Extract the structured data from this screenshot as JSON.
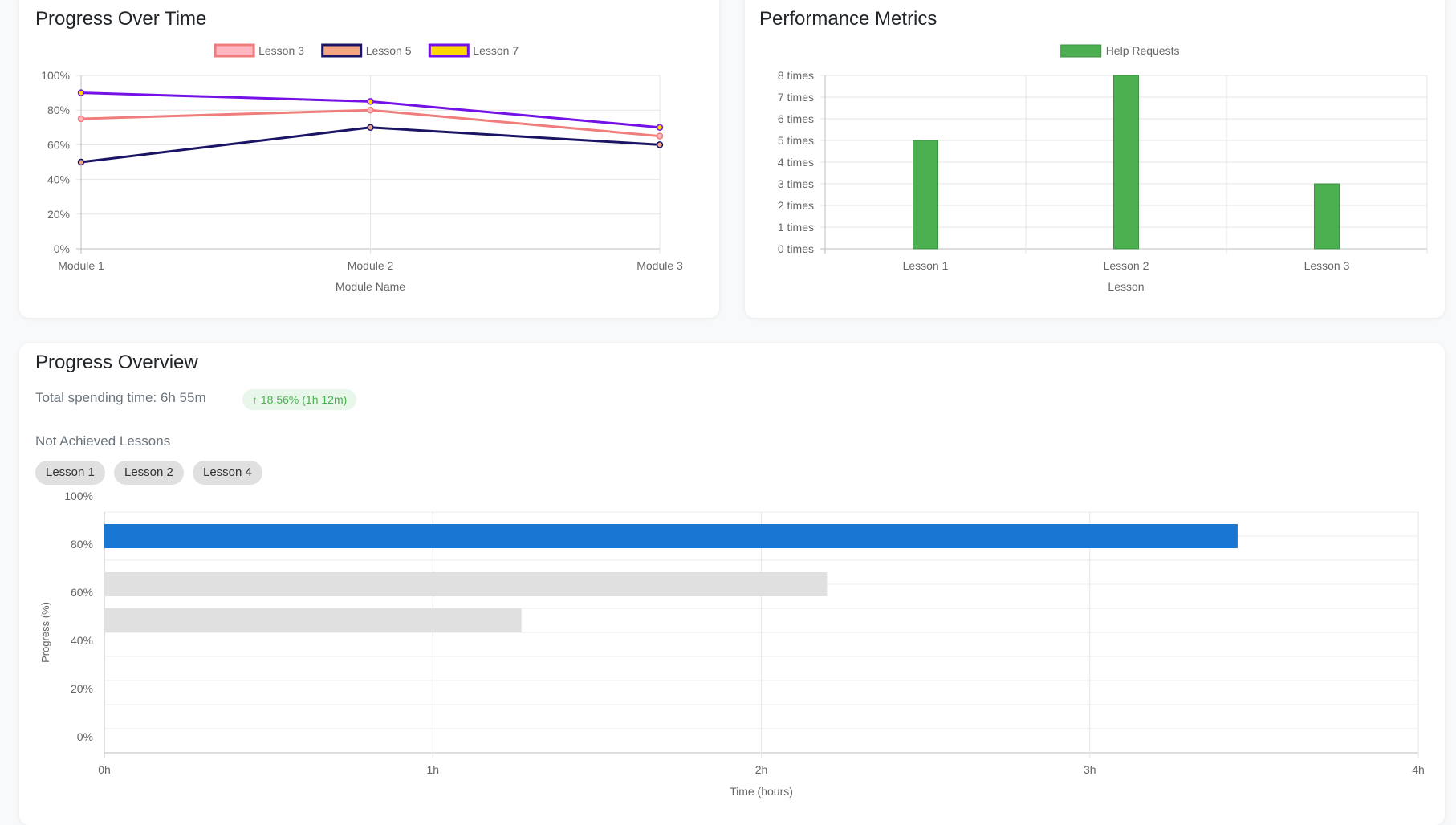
{
  "progress_card": {
    "title": "Progress Over Time",
    "chart_data": {
      "type": "line",
      "categories": [
        "Module 1",
        "Module 2",
        "Module 3"
      ],
      "xlabel": "Module Name",
      "ylabel": "",
      "ylim": [
        0,
        100
      ],
      "y_ticks": [
        "0%",
        "20%",
        "40%",
        "60%",
        "80%",
        "100%"
      ],
      "grid": true,
      "legend": "top",
      "series": [
        {
          "name": "Lesson 3",
          "values": [
            75,
            80,
            65
          ],
          "line_color": "#f07c7c",
          "fill_color": "#ffb6c1"
        },
        {
          "name": "Lesson 5",
          "values": [
            50,
            70,
            60
          ],
          "line_color": "#1b1464",
          "fill_color": "#f4a582"
        },
        {
          "name": "Lesson 7",
          "values": [
            90,
            85,
            70
          ],
          "line_color": "#7311e6",
          "fill_color": "#ffd700"
        }
      ]
    }
  },
  "metrics_card": {
    "title": "Performance Metrics",
    "chart_data": {
      "type": "bar",
      "categories": [
        "Lesson 1",
        "Lesson 2",
        "Lesson 3"
      ],
      "xlabel": "Lesson",
      "ylabel": "",
      "ylim": [
        0,
        8
      ],
      "y_ticks": [
        "0 times",
        "1 times",
        "2 times",
        "3 times",
        "4 times",
        "5 times",
        "6 times",
        "7 times",
        "8 times"
      ],
      "grid": true,
      "legend": "top",
      "series": [
        {
          "name": "Help Requests",
          "values": [
            5,
            8,
            3
          ],
          "color": "#4caf50"
        }
      ]
    }
  },
  "overview_card": {
    "title": "Progress Overview",
    "total_time": "Total spending time: 6h 55m",
    "change_badge": "↑ 18.56% (1h 12m)",
    "not_achieved_label": "Not Achieved Lessons",
    "not_achieved_lessons": [
      "Lesson 1",
      "Lesson 2",
      "Lesson 4"
    ],
    "chart_data": {
      "type": "bar",
      "orientation": "horizontal",
      "xlabel": "Time (hours)",
      "ylabel": "Progress (%)",
      "xlim": [
        0,
        4
      ],
      "ylim": [
        0,
        100
      ],
      "x_ticks": [
        "0h",
        "1h",
        "2h",
        "3h",
        "4h"
      ],
      "y_ticks": [
        "0%",
        "20%",
        "40%",
        "60%",
        "80%",
        "100%"
      ],
      "grid": true,
      "bars": [
        {
          "progress": 90,
          "time": 3.45,
          "color": "#1976d2"
        },
        {
          "progress": 70,
          "time": 2.2,
          "color": "#e0e0e0"
        },
        {
          "progress": 55,
          "time": 1.27,
          "color": "#e0e0e0"
        }
      ]
    }
  }
}
